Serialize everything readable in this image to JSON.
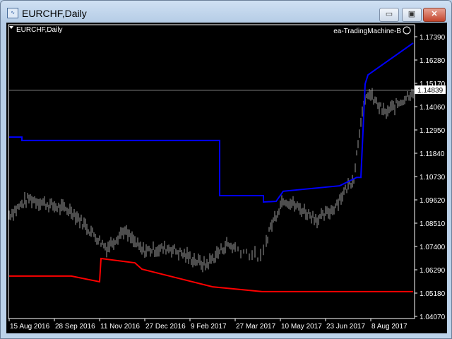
{
  "window": {
    "title": "EURCHF,Daily",
    "minimize": "▭",
    "maximize": "▣",
    "close": "✕"
  },
  "chart_header": {
    "symbol": "EURCHF,Daily",
    "expert": "ea-TradingMachine-B",
    "expert_icon": "smiley-icon"
  },
  "current_price": "1.14839",
  "colors": {
    "upper": "#0000ff",
    "lower": "#ff0000",
    "bars": "#9a9a9a",
    "price_line": "#b0b0b0"
  },
  "chart_data": {
    "type": "line",
    "title": "EURCHF,Daily",
    "yticks": [
      "1.17390",
      "1.16280",
      "1.15170",
      "1.14060",
      "1.12950",
      "1.11840",
      "1.10730",
      "1.09620",
      "1.08510",
      "1.07400",
      "1.06290",
      "1.05180",
      "1.04070"
    ],
    "ylim": [
      1.0374,
      1.1794
    ],
    "xticks": [
      {
        "label": "15 Aug 2016",
        "bar": 0
      },
      {
        "label": "28 Sep 2016",
        "bar": 32
      },
      {
        "label": "11 Nov 2016",
        "bar": 64
      },
      {
        "label": "27 Dec 2016",
        "bar": 96
      },
      {
        "label": "9 Feb 2017",
        "bar": 128
      },
      {
        "label": "27 Mar 2017",
        "bar": 160
      },
      {
        "label": "10 May 2017",
        "bar": 192
      },
      {
        "label": "23 Jun 2017",
        "bar": 224
      },
      {
        "label": "8 Aug 2017",
        "bar": 256
      }
    ],
    "xlim": [
      0,
      290
    ],
    "series": [
      {
        "name": "upper",
        "points": [
          [
            0,
            1.1261
          ],
          [
            9,
            1.1261
          ],
          [
            9,
            1.1245
          ],
          [
            149,
            1.1245
          ],
          [
            149,
            1.0982
          ],
          [
            180,
            1.0982
          ],
          [
            180,
            1.0952
          ],
          [
            189,
            1.0955
          ],
          [
            194,
            1.1003
          ],
          [
            234,
            1.1029
          ],
          [
            246,
            1.1069
          ],
          [
            249,
            1.1069
          ],
          [
            252,
            1.1514
          ],
          [
            254,
            1.1557
          ],
          [
            286,
            1.1709
          ]
        ]
      },
      {
        "name": "lower",
        "points": [
          [
            0,
            1.0599
          ],
          [
            44,
            1.0599
          ],
          [
            64,
            1.0572
          ],
          [
            65,
            1.0683
          ],
          [
            89,
            1.0662
          ],
          [
            94,
            1.0632
          ],
          [
            144,
            1.0548
          ],
          [
            179,
            1.0525
          ],
          [
            286,
            1.0525
          ]
        ]
      },
      {
        "name": "price",
        "points": [
          [
            0,
            1.089
          ],
          [
            14,
            1.0969
          ],
          [
            30,
            1.0935
          ],
          [
            44,
            1.091
          ],
          [
            69,
            1.0733
          ],
          [
            81,
            1.0817
          ],
          [
            94,
            1.072
          ],
          [
            114,
            1.0733
          ],
          [
            139,
            1.065
          ],
          [
            154,
            1.075
          ],
          [
            179,
            1.0683
          ],
          [
            184,
            1.0817
          ],
          [
            194,
            1.0969
          ],
          [
            219,
            1.0868
          ],
          [
            229,
            1.0918
          ],
          [
            244,
            1.1069
          ],
          [
            249,
            1.135
          ],
          [
            254,
            1.1473
          ],
          [
            266,
            1.1373
          ],
          [
            279,
            1.144
          ],
          [
            286,
            1.1484
          ]
        ]
      }
    ]
  }
}
